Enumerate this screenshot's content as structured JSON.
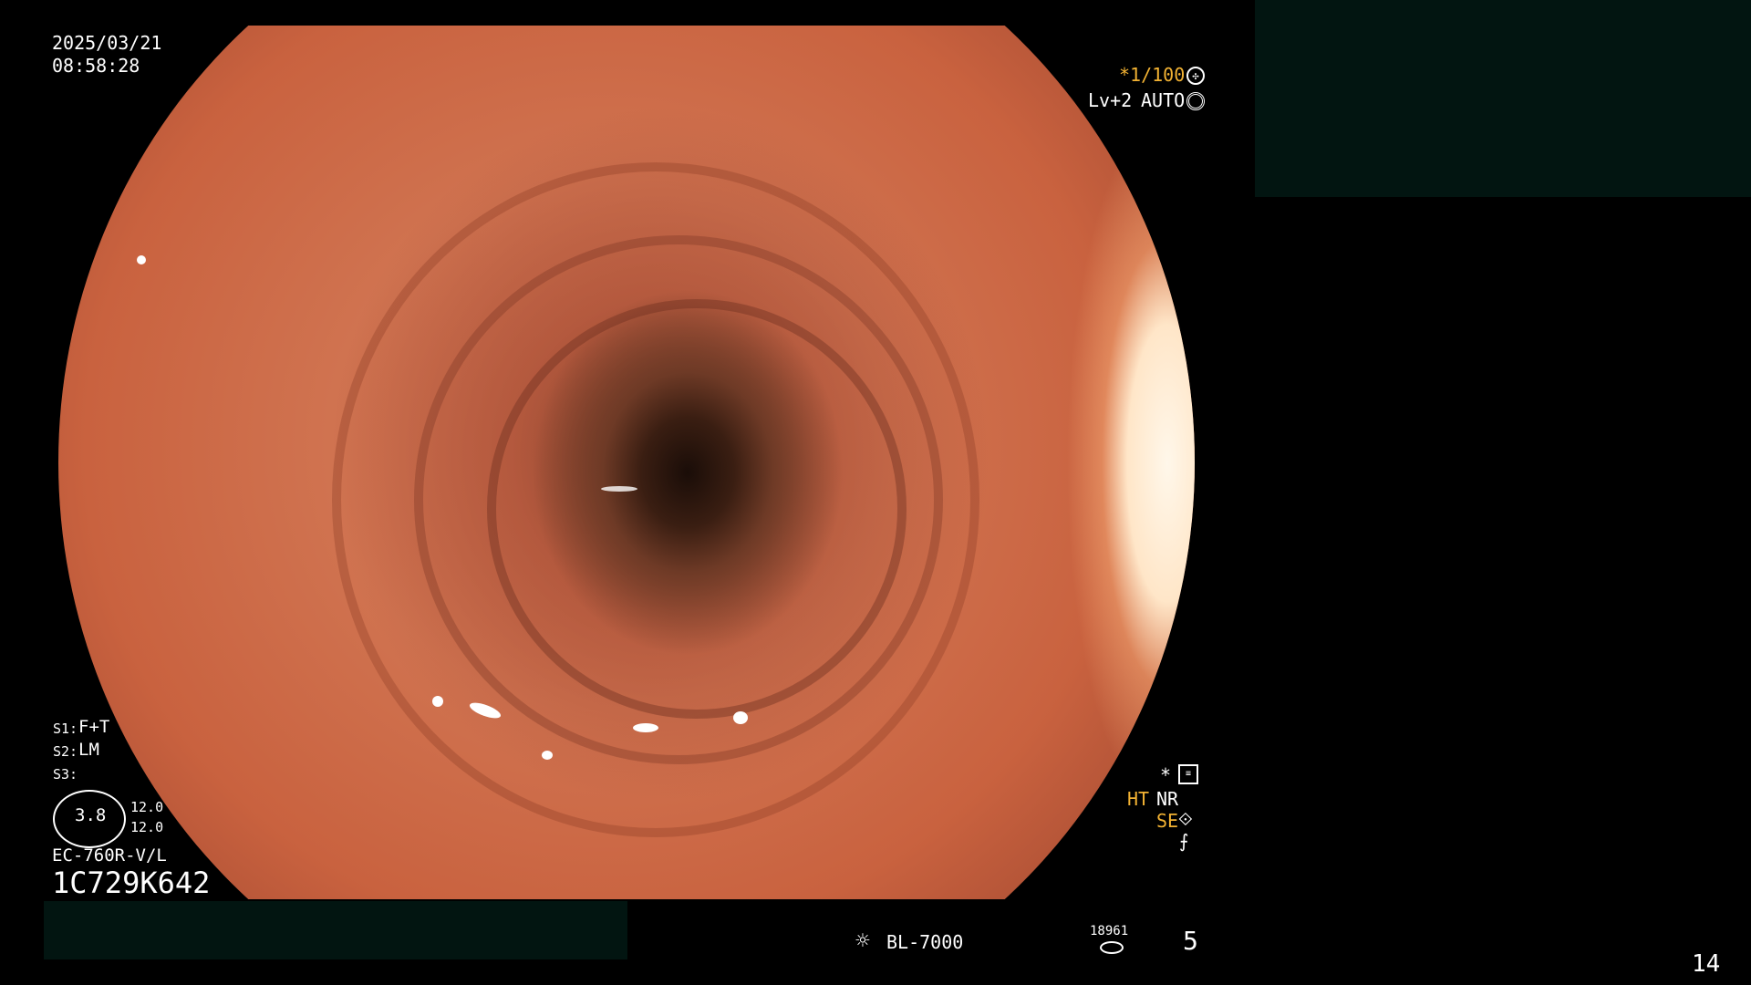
{
  "header": {
    "date": "2025/03/21",
    "time": "08:58:28",
    "shutter": "*1/100",
    "level": "Lv+2",
    "mode": "AUTO"
  },
  "settings": {
    "s1_label": "S1:",
    "s1_value": "F+T",
    "s2_label": "S2:",
    "s2_value": "LM",
    "s3_label": "S3:",
    "zoom": "3.8",
    "zoom_val1": "12.0",
    "zoom_val2": "12.0",
    "scope_model": "EC-760R-V/L",
    "serial": "1C729K642"
  },
  "right_status": {
    "star": "*",
    "ht": "HT",
    "nr": "NR",
    "se": "SE"
  },
  "footer": {
    "light_source": "BL-7000",
    "counter": "18961",
    "count_value": "5",
    "page_number": "14"
  },
  "colors": {
    "accent_orange": "#f2b233",
    "redact_fill": "#021511"
  },
  "icons": [
    "shutter-icon",
    "auto-icon",
    "filter-icon",
    "se-icon",
    "enhance-icon",
    "light-icon",
    "counter-icon"
  ]
}
